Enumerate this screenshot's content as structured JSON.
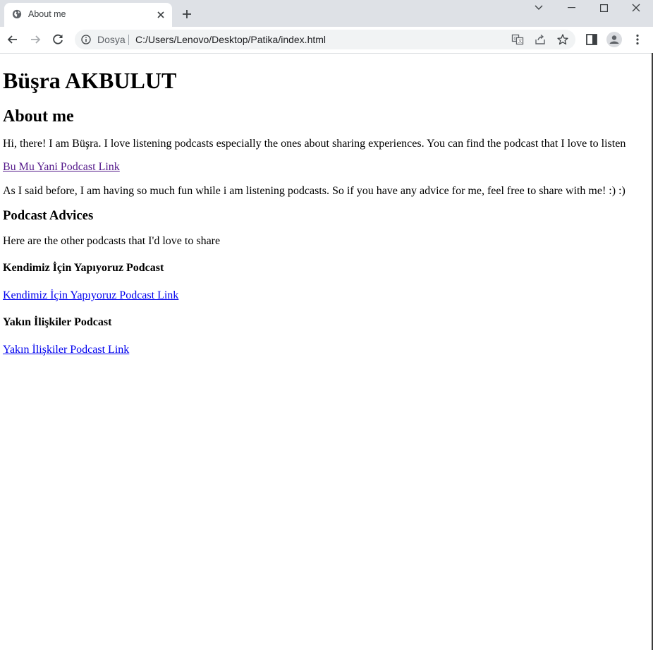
{
  "browser": {
    "tab_title": "About me",
    "address_label": "Dosya",
    "url": "C:/Users/Lenovo/Desktop/Patika/index.html"
  },
  "page": {
    "name": "Büşra AKBULUT",
    "about_heading": "About me",
    "intro": "Hi, there! I am Büşra. I love listening podcasts especially the ones about sharing experiences. You can find the podcast that I love to listen",
    "main_link": "Bu Mu Yani Podcast Link",
    "outro": "As I said before, I am having so much fun while i am listening podcasts. So if you have any advice for me, feel free to share with me! :) :)",
    "advices_heading": "Podcast Advices",
    "advices_intro": "Here are the other podcasts that I'd love to share",
    "podcasts": [
      {
        "title": "Kendimiz İçin Yapıyoruz Podcast",
        "link": "Kendimiz İçin Yapıyoruz Podcast Link"
      },
      {
        "title": "Yakın İlişkiler Podcast",
        "link": "Yakın İlişkiler Podcast Link"
      }
    ]
  }
}
